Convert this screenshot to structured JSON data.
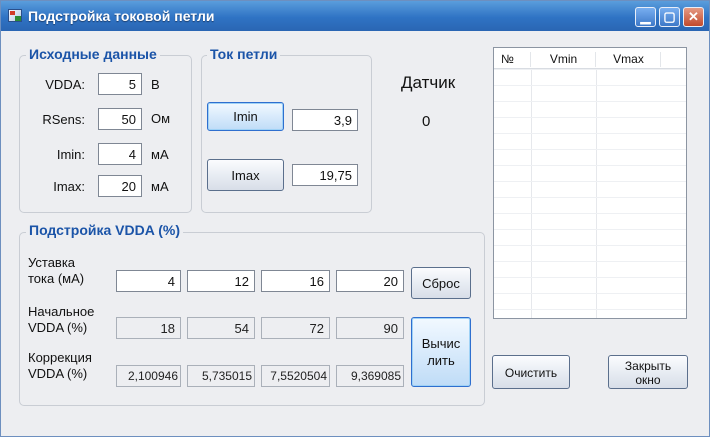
{
  "window": {
    "title": "Подстройка токовой петли",
    "minimize": "▁",
    "maximize": "▢",
    "close": "✕"
  },
  "source": {
    "title": "Исходные данные",
    "rows": [
      {
        "label": "VDDA:",
        "value": "5",
        "unit": "В"
      },
      {
        "label": "RSens:",
        "value": "50",
        "unit": "Ом"
      },
      {
        "label": "Imin:",
        "value": "4",
        "unit": "мА"
      },
      {
        "label": "Imax:",
        "value": "20",
        "unit": "мА"
      }
    ]
  },
  "loop": {
    "title": "Ток петли",
    "imin_button": "Imin",
    "imin_value": "3,9",
    "imax_button": "Imax",
    "imax_value": "19,75"
  },
  "sensor": {
    "label": "Датчик",
    "value": "0"
  },
  "table": {
    "headers": [
      "№",
      "Vmin",
      "Vmax"
    ],
    "rows": []
  },
  "vdda": {
    "title": "Подстройка VDDA (%)",
    "setpoint": {
      "label1": "Уставка",
      "label2": "тока (мА)",
      "values": [
        "4",
        "12",
        "16",
        "20"
      ]
    },
    "initial": {
      "label1": "Начальное",
      "label2": "VDDA (%)",
      "values": [
        "18",
        "54",
        "72",
        "90"
      ]
    },
    "correction": {
      "label1": "Коррекция",
      "label2": "VDDA (%)",
      "values": [
        "2,100946",
        "5,735015",
        "7,5520504",
        "9,369085"
      ]
    },
    "reset_button": "Сброс",
    "calc_button_line1": "Вычис",
    "calc_button_line2": "лить"
  },
  "actions": {
    "clear_button": "Очистить",
    "close_line1": "Закрыть",
    "close_line2": "окно"
  }
}
